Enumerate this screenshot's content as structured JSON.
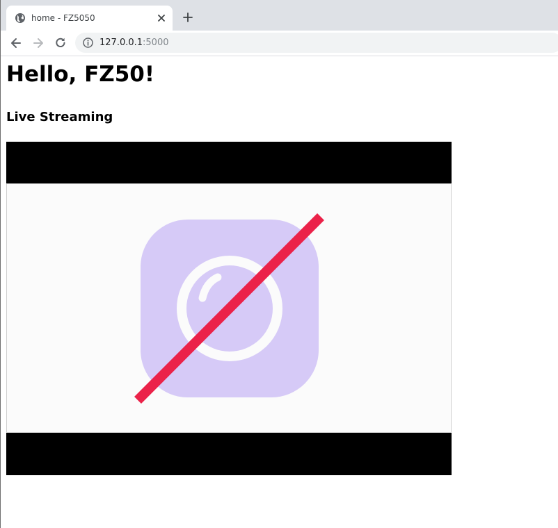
{
  "browser": {
    "tab": {
      "title": "home - FZ5050"
    },
    "address": {
      "host": "127.0.0.1",
      "port": ":5000"
    }
  },
  "page": {
    "heading": "Hello, FZ50!",
    "subheading": "Live Streaming",
    "stream": {
      "status": "no-camera-icon"
    }
  },
  "colors": {
    "camera_icon": "#d6caf7",
    "slash": "#eb2249",
    "video_bg": "#000000",
    "placeholder_bg": "#fbfbfb"
  }
}
